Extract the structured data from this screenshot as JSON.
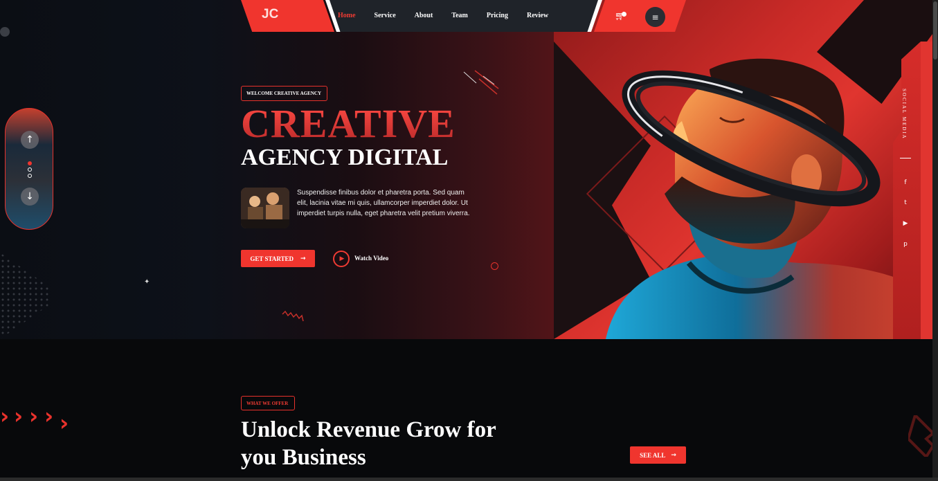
{
  "nav": {
    "logo": "JC",
    "links": [
      "Home",
      "Service",
      "About",
      "Team",
      "Pricing",
      "Review"
    ],
    "active": "Home",
    "cart_icon": "cart-icon",
    "menu_icon": "hamburger-icon"
  },
  "hero": {
    "tag": "WELCOME CREATIVE AGENCY",
    "title_line1": "CREATIVE",
    "title_line2": "AGENCY DIGITAL",
    "description": "Suspendisse finibus dolor et pharetra porta. Sed quam elit, lacinia vitae mi quis, ullamcorper imperdiet dolor. Ut imperdiet turpis nulla, eget pharetra velit pretium viverra.",
    "cta_label": "GET STARTED",
    "cta_arrow": "→",
    "watch_label": "Watch Video"
  },
  "slider_control": {
    "up_icon": "↑",
    "down_icon": "↓"
  },
  "social": {
    "label": "SOCIAL MEDIA",
    "icons": [
      "facebook-icon",
      "twitter-icon",
      "youtube-icon",
      "pinterest-icon"
    ],
    "glyphs": [
      "f",
      "t",
      "▶",
      "p"
    ]
  },
  "offer": {
    "tag": "WHAT WE OFFER",
    "heading": "Unlock Revenue Grow for you Business",
    "see_all": "SEE ALL",
    "see_all_arrow": "→"
  },
  "colors": {
    "accent": "#f0352e",
    "background": "#08090b",
    "nav_dark": "#1f2329"
  }
}
